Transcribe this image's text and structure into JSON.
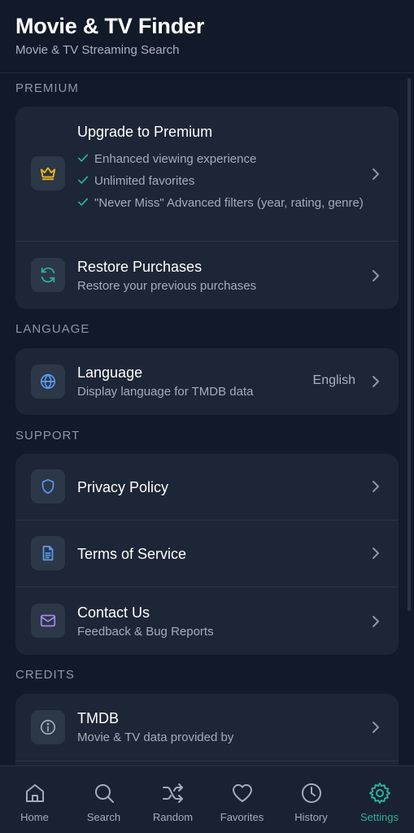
{
  "header": {
    "title": "Movie & TV Finder",
    "subtitle": "Movie & TV Streaming Search"
  },
  "sections": {
    "premium": "PREMIUM",
    "language": "LANGUAGE",
    "support": "SUPPORT",
    "credits": "CREDITS"
  },
  "premium": {
    "title": "Upgrade to Premium",
    "features": [
      "Enhanced viewing experience",
      "Unlimited favorites",
      "\"Never Miss\" Advanced filters (year, rating, genre)"
    ],
    "restore_title": "Restore Purchases",
    "restore_sub": "Restore your previous purchases"
  },
  "language": {
    "title": "Language",
    "sub": "Display language for TMDB data",
    "value": "English"
  },
  "support": {
    "privacy": "Privacy Policy",
    "terms": "Terms of Service",
    "contact_title": "Contact Us",
    "contact_sub": "Feedback & Bug Reports"
  },
  "credits": {
    "title": "TMDB",
    "sub": "Movie & TV data provided by"
  },
  "tabs": [
    {
      "label": "Home",
      "icon": "home-icon"
    },
    {
      "label": "Search",
      "icon": "search-icon"
    },
    {
      "label": "Random",
      "icon": "shuffle-icon"
    },
    {
      "label": "Favorites",
      "icon": "heart-icon"
    },
    {
      "label": "History",
      "icon": "clock-icon"
    },
    {
      "label": "Settings",
      "icon": "gear-icon",
      "active": true
    }
  ],
  "colors": {
    "background": "#121a29",
    "card": "#1d2636",
    "accent": "#2dae9b",
    "crown": "#e8b923",
    "restore": "#2dae9b",
    "globe": "#5b9bef",
    "shield": "#5b9bef",
    "document": "#5b9bef",
    "mail": "#a98bf0"
  }
}
